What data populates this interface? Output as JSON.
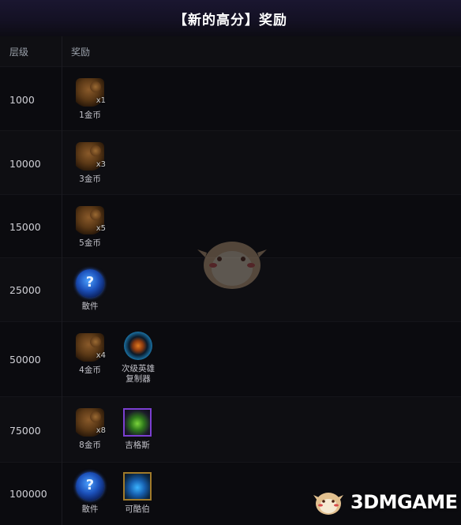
{
  "title": "【新的高分】奖励",
  "header": {
    "tier": "层级",
    "reward": "奖励"
  },
  "rows": [
    {
      "tier": "1000",
      "rewards": [
        {
          "icon": "chest-icon",
          "qty": "x1",
          "label": "1金币"
        }
      ]
    },
    {
      "tier": "10000",
      "rewards": [
        {
          "icon": "chest-icon",
          "qty": "x3",
          "label": "3金币"
        }
      ]
    },
    {
      "tier": "15000",
      "rewards": [
        {
          "icon": "chest-icon",
          "qty": "x5",
          "label": "5金币"
        }
      ]
    },
    {
      "tier": "25000",
      "rewards": [
        {
          "icon": "mystery-orb-icon",
          "qty": "",
          "label": "散件"
        }
      ]
    },
    {
      "tier": "50000",
      "rewards": [
        {
          "icon": "chest-icon",
          "qty": "x4",
          "label": "4金币"
        },
        {
          "icon": "hero-copier-icon",
          "qty": "",
          "label": "次级英雄复制器"
        }
      ]
    },
    {
      "tier": "75000",
      "rewards": [
        {
          "icon": "chest-icon",
          "qty": "x8",
          "label": "8金币"
        },
        {
          "icon": "champion-icon",
          "qty": "",
          "label": "吉格斯"
        }
      ]
    },
    {
      "tier": "100000",
      "rewards": [
        {
          "icon": "mystery-orb-icon",
          "qty": "",
          "label": "散件"
        },
        {
          "icon": "champion-icon",
          "qty": "",
          "label": "可酷伯"
        }
      ]
    }
  ],
  "watermark": "3DMGAME"
}
